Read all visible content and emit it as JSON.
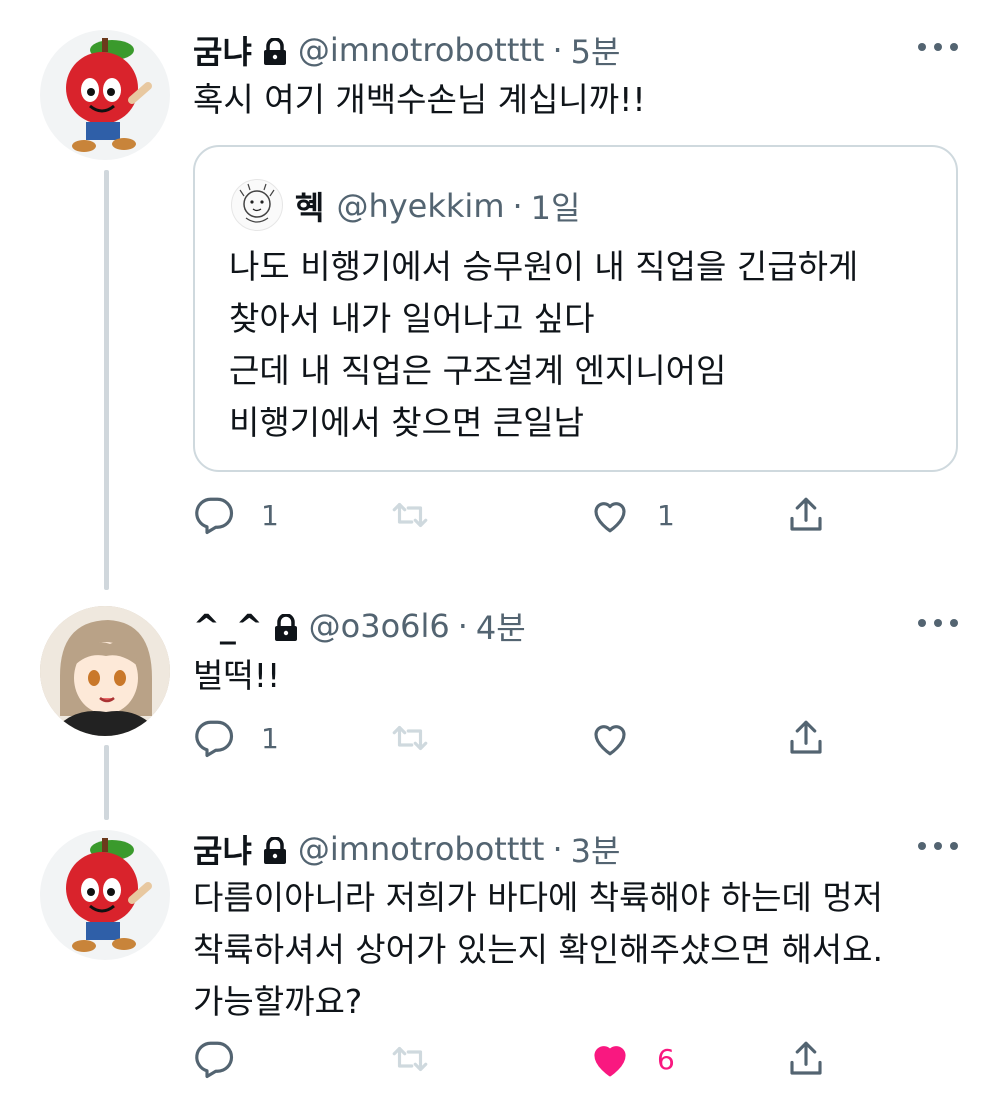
{
  "tweets": [
    {
      "name": "굼냐",
      "handle": "@imnotrobotttt",
      "dot": "·",
      "time": "5분",
      "text": "혹시 여기 개백수손님 계십니까!!",
      "quote": {
        "name": "혝",
        "handle": "@hyekkim",
        "dot": "·",
        "time": "1일",
        "lines": [
          "나도 비행기에서 승무원이 내 직업을 긴급하게",
          "찾아서 내가 일어나고 싶다",
          "근데 내 직업은 구조설계 엔지니어임",
          "비행기에서 찾으면 큰일남"
        ]
      },
      "replies": "1",
      "likes": "1",
      "liked": false
    },
    {
      "name": "^_^",
      "handle": "@o3o6l6",
      "dot": "·",
      "time": "4분",
      "text": "벌떡!!",
      "replies": "1",
      "likes": "",
      "liked": false
    },
    {
      "name": "굼냐",
      "handle": "@imnotrobotttt",
      "dot": "·",
      "time": "3분",
      "lines": [
        "다름이아니라 저희가 바다에 착륙해야 하는데 멍저",
        "착륙하셔서 상어가 있는지 확인해주샸으면 해서요.",
        "가능할까요?"
      ],
      "replies": "",
      "likes": "6",
      "liked": true
    }
  ],
  "icons": {
    "reply": "reply-icon",
    "retweet": "retweet-icon",
    "like": "heart-icon",
    "share": "share-icon",
    "lock": "lock-icon",
    "more": "more-icon"
  },
  "colors": {
    "text": "#0f1419",
    "secondary": "#536471",
    "like_active": "#f91880",
    "border": "#cfd9de",
    "thread_line": "#d0d7dc"
  }
}
